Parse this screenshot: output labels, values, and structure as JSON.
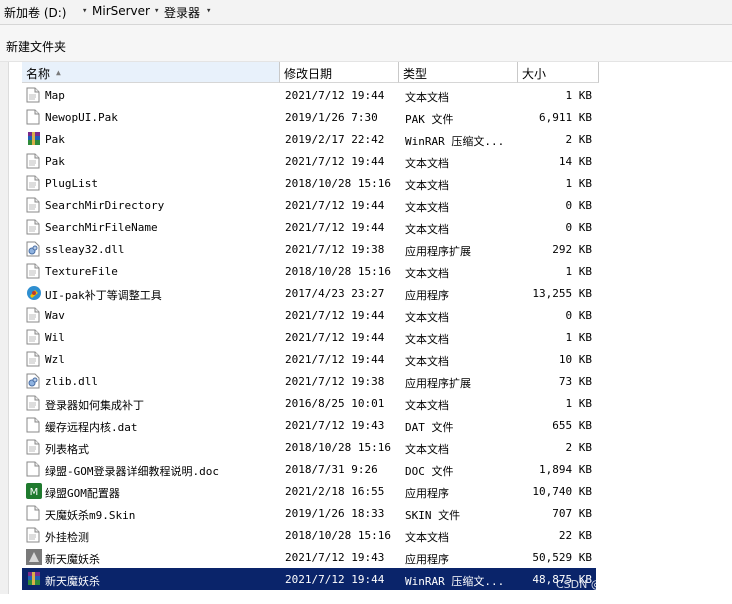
{
  "address": {
    "crumbs": [
      "新加卷 (D:)",
      "MirServer",
      "登录器"
    ]
  },
  "toolbar": {
    "new_folder": "新建文件夹"
  },
  "columns": {
    "name": "名称",
    "date": "修改日期",
    "type": "类型",
    "size": "大小"
  },
  "rows": [
    {
      "name": "Map",
      "date": "2021/7/12 19:44",
      "type": "文本文档",
      "size": "1 KB",
      "icon": "text-file-icon"
    },
    {
      "name": "NewopUI.Pak",
      "date": "2019/1/26 7:30",
      "type": "PAK 文件",
      "size": "6,911 KB",
      "icon": "generic-file-icon"
    },
    {
      "name": "Pak",
      "date": "2019/2/17 22:42",
      "type": "WinRAR 压缩文...",
      "size": "2 KB",
      "icon": "winrar-icon"
    },
    {
      "name": "Pak",
      "date": "2021/7/12 19:44",
      "type": "文本文档",
      "size": "14 KB",
      "icon": "text-file-icon"
    },
    {
      "name": "PlugList",
      "date": "2018/10/28 15:16",
      "type": "文本文档",
      "size": "1 KB",
      "icon": "text-file-icon"
    },
    {
      "name": "SearchMirDirectory",
      "date": "2021/7/12 19:44",
      "type": "文本文档",
      "size": "0 KB",
      "icon": "text-file-icon"
    },
    {
      "name": "SearchMirFileName",
      "date": "2021/7/12 19:44",
      "type": "文本文档",
      "size": "0 KB",
      "icon": "text-file-icon"
    },
    {
      "name": "ssleay32.dll",
      "date": "2021/7/12 19:38",
      "type": "应用程序扩展",
      "size": "292 KB",
      "icon": "dll-icon"
    },
    {
      "name": "TextureFile",
      "date": "2018/10/28 15:16",
      "type": "文本文档",
      "size": "1 KB",
      "icon": "text-file-icon"
    },
    {
      "name": "UI-pak补丁等调整工具",
      "date": "2017/4/23 23:27",
      "type": "应用程序",
      "size": "13,255 KB",
      "icon": "tool-app-icon"
    },
    {
      "name": "Wav",
      "date": "2021/7/12 19:44",
      "type": "文本文档",
      "size": "0 KB",
      "icon": "text-file-icon"
    },
    {
      "name": "Wil",
      "date": "2021/7/12 19:44",
      "type": "文本文档",
      "size": "1 KB",
      "icon": "text-file-icon"
    },
    {
      "name": "Wzl",
      "date": "2021/7/12 19:44",
      "type": "文本文档",
      "size": "10 KB",
      "icon": "text-file-icon"
    },
    {
      "name": "zlib.dll",
      "date": "2021/7/12 19:38",
      "type": "应用程序扩展",
      "size": "73 KB",
      "icon": "dll-icon"
    },
    {
      "name": "登录器如何集成补丁",
      "date": "2016/8/25 10:01",
      "type": "文本文档",
      "size": "1 KB",
      "icon": "text-file-icon"
    },
    {
      "name": "缓存远程内核.dat",
      "date": "2021/7/12 19:43",
      "type": "DAT 文件",
      "size": "655 KB",
      "icon": "generic-file-icon"
    },
    {
      "name": "列表格式",
      "date": "2018/10/28 15:16",
      "type": "文本文档",
      "size": "2 KB",
      "icon": "text-file-icon"
    },
    {
      "name": "绿盟-GOM登录器详细教程说明.doc",
      "date": "2018/7/31 9:26",
      "type": "DOC 文件",
      "size": "1,894 KB",
      "icon": "generic-file-icon"
    },
    {
      "name": "绿盟GOM配置器",
      "date": "2021/2/18 16:55",
      "type": "应用程序",
      "size": "10,740 KB",
      "icon": "green-app-icon"
    },
    {
      "name": "天魔妖杀m9.Skin",
      "date": "2019/1/26 18:33",
      "type": "SKIN 文件",
      "size": "707 KB",
      "icon": "generic-file-icon"
    },
    {
      "name": "外挂检测",
      "date": "2018/10/28 15:16",
      "type": "文本文档",
      "size": "22 KB",
      "icon": "text-file-icon"
    },
    {
      "name": "新天魔妖杀",
      "date": "2021/7/12 19:43",
      "type": "应用程序",
      "size": "50,529 KB",
      "icon": "game-app-icon"
    },
    {
      "name": "新天魔妖杀",
      "date": "2021/7/12 19:44",
      "type": "WinRAR 压缩文...",
      "size": "48,875 KB",
      "icon": "winrar-icon"
    }
  ],
  "selected_row": 22,
  "watermark": "CSDN @IDC02_FEIYA",
  "colors": {
    "selection": "#0a246a",
    "background": "#ffffff"
  }
}
